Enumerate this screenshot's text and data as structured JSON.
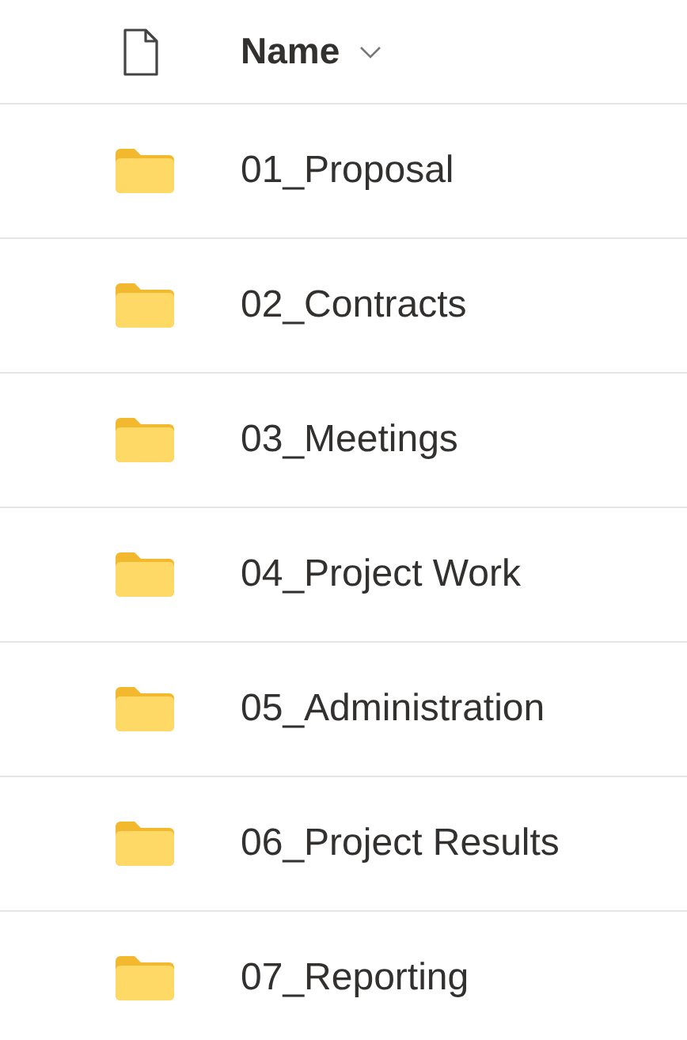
{
  "header": {
    "column": "Name",
    "sorted": true
  },
  "rows": [
    {
      "name": "01_Proposal"
    },
    {
      "name": "02_Contracts"
    },
    {
      "name": "03_Meetings"
    },
    {
      "name": "04_Project Work"
    },
    {
      "name": "05_Administration"
    },
    {
      "name": "06_Project Results"
    },
    {
      "name": "07_Reporting"
    }
  ]
}
